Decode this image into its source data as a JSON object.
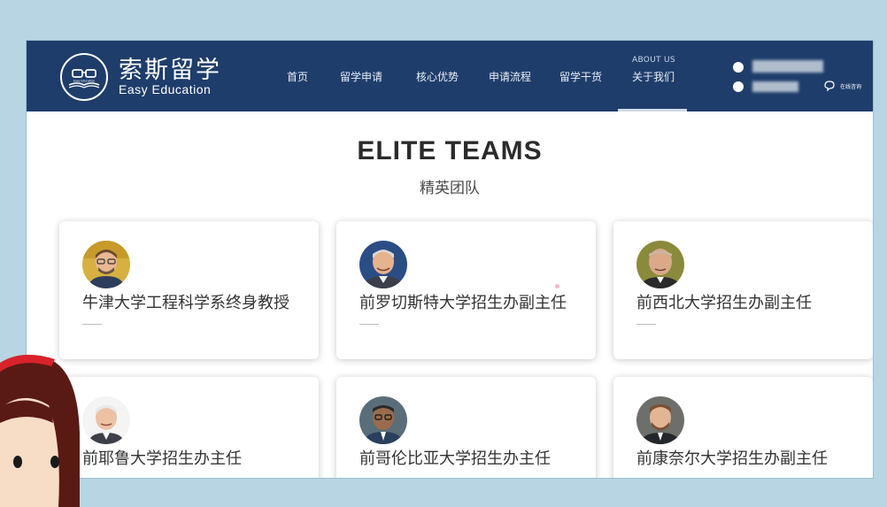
{
  "brand": {
    "name_cn": "索斯留学",
    "name_en": "Easy Education",
    "logo_text": "Easy Education"
  },
  "nav": {
    "items": [
      {
        "label": "首页"
      },
      {
        "label": "留学申请"
      },
      {
        "label": "核心优势"
      },
      {
        "label": "申请流程"
      },
      {
        "label": "留学干货"
      }
    ],
    "about_en": "ABOUT US",
    "about_cn": "关于我们"
  },
  "contact": {
    "online_consult": "在线咨询"
  },
  "section": {
    "title": "ELITE TEAMS",
    "subtitle": "精英团队"
  },
  "team": [
    {
      "title": "牛津大学工程科学系终身教授",
      "avatar": "man-glasses-beard"
    },
    {
      "title": "前罗切斯特大学招生办副主任",
      "avatar": "man-grey-hair-smiling"
    },
    {
      "title": "前西北大学招生办副主任",
      "avatar": "man-bald-olive-background"
    },
    {
      "title": "前耶鲁大学招生办主任",
      "avatar": "man-white-hair"
    },
    {
      "title": "前哥伦比亚大学招生办主任",
      "avatar": "man-glasses-dark-suit"
    },
    {
      "title": "前康奈尔大学招生办副主任",
      "avatar": "man-beard-suit"
    }
  ],
  "colors": {
    "header_bg": "#1f3d6b",
    "page_frame": "#b8d5e3",
    "cartoon_hair": "#5a1a14",
    "cartoon_bow": "#d8232a"
  }
}
